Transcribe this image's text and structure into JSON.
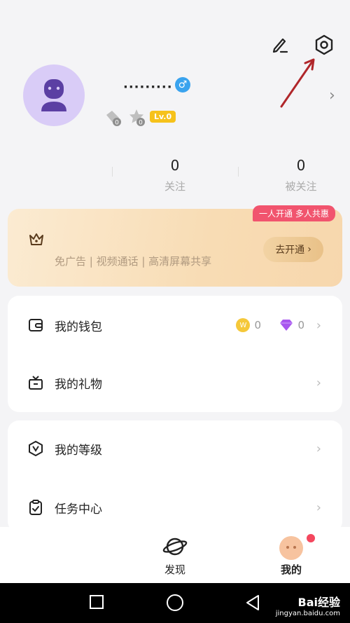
{
  "profile": {
    "nickname": "·········",
    "gender_symbol": "♂",
    "level": "Lv.0",
    "badge_count_1": "0",
    "badge_count_2": "0"
  },
  "stats": [
    {
      "value": "0",
      "label": "关注"
    },
    {
      "value": "0",
      "label": "被关注"
    }
  ],
  "vip": {
    "tag": "一人开通 多人共惠",
    "description": "免广告 | 视频通话 | 高清屏幕共享",
    "button": "去开通"
  },
  "menu_group_1": [
    {
      "label": "我的钱包",
      "icon": "wallet-icon",
      "coins": "0",
      "diamonds": "0"
    },
    {
      "label": "我的礼物",
      "icon": "gift-icon"
    }
  ],
  "menu_group_2": [
    {
      "label": "我的等级",
      "icon": "level-shield-icon"
    },
    {
      "label": "任务中心",
      "icon": "task-clipboard-icon"
    }
  ],
  "tabs": [
    {
      "label": "发现",
      "icon": "planet-icon"
    },
    {
      "label": "我的",
      "icon": "me-avatar-icon"
    }
  ],
  "watermark": {
    "brand": "Bai经验",
    "url": "jingyan.baidu.com"
  },
  "colors": {
    "accent_purple": "#d9ccf7",
    "vip_tag": "#f1546e",
    "gender_blue": "#3aa3ee",
    "level_yellow": "#f6c21b",
    "arrow_annotation": "#b0262a"
  }
}
